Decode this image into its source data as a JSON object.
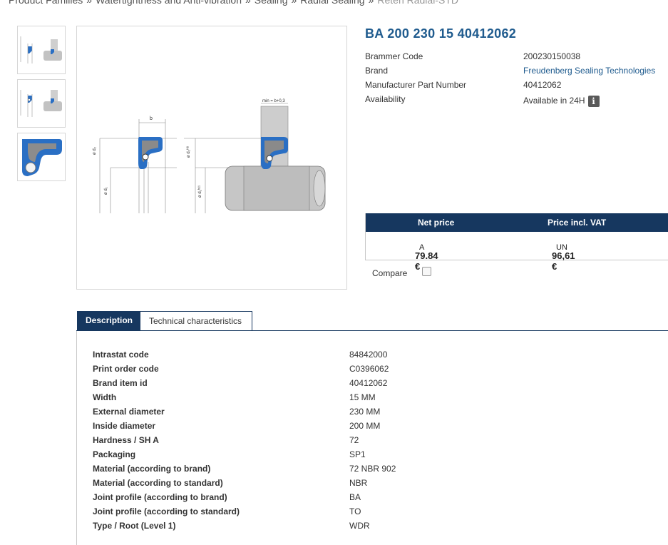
{
  "breadcrumb": [
    "Product Families",
    "Watertightness and Anti-vibration",
    "Sealing",
    "Radial Sealing",
    "Reten Radial-STD"
  ],
  "product": {
    "title": "BA 200 230 15 40412062",
    "brammer_code_label": "Brammer Code",
    "brammer_code": "200230150038",
    "brand_label": "Brand",
    "brand": "Freudenberg Sealing Technologies",
    "mpn_label": "Manufacturer Part Number",
    "mpn": "40412062",
    "availability_label": "Availability",
    "availability": "Available in 24H",
    "info_icon": "i"
  },
  "drawing": {
    "b_label": "b",
    "d2_label": "ø d₂",
    "d1_label": "ø d₁",
    "d2h8_label": "ø d₂ᴴ⁸",
    "d1h11_label": "ø d₁ʰ¹¹",
    "min_label": "min = b+0,3"
  },
  "price": {
    "net_label": "Net price",
    "vat_label": "Price incl. VAT",
    "net_value": "79.84 €",
    "net_unit": "A",
    "vat_value": "96,61 €",
    "vat_unit": "UN"
  },
  "compare_label": "Compare",
  "tabs": {
    "description": "Description",
    "technical": "Technical characteristics"
  },
  "specs": [
    {
      "k": "Intrastat code",
      "v": "84842000"
    },
    {
      "k": "Print order code",
      "v": "C0396062"
    },
    {
      "k": "Brand item id",
      "v": "40412062"
    },
    {
      "k": "Width",
      "v": "15 MM"
    },
    {
      "k": "External diameter",
      "v": "230 MM"
    },
    {
      "k": "Inside diameter",
      "v": "200 MM"
    },
    {
      "k": "Hardness / SH A",
      "v": "72"
    },
    {
      "k": "Packaging",
      "v": "SP1"
    },
    {
      "k": "Material (according to brand)",
      "v": "72 NBR 902"
    },
    {
      "k": "Material (according to standard)",
      "v": "NBR"
    },
    {
      "k": "Joint profile (according to brand)",
      "v": "BA"
    },
    {
      "k": "Joint profile (according to standard)",
      "v": "TO"
    },
    {
      "k": "Type / Root (Level 1)",
      "v": "WDR"
    }
  ],
  "colors": {
    "brand_blue": "#16375f",
    "seal_blue": "#2a6fc4",
    "link": "#1f5b8e"
  }
}
